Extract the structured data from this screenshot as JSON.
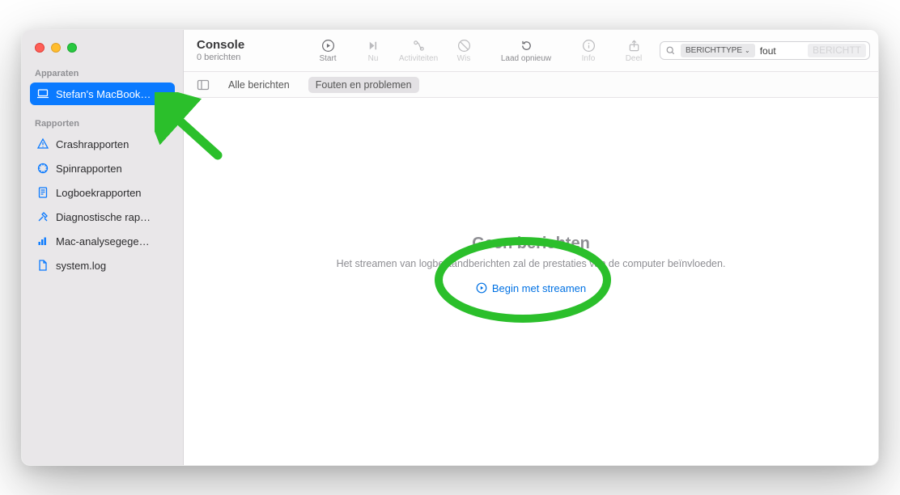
{
  "window": {
    "title": "Console",
    "subtitle": "0 berichten"
  },
  "toolbar": {
    "start": "Start",
    "now": "Nu",
    "activities": "Activiteiten",
    "clear": "Wis",
    "reload": "Laad opnieuw",
    "info": "Info",
    "share": "Deel"
  },
  "search": {
    "token_label": "BERICHTTYPE",
    "token_chevron": "⌄",
    "query": "fout",
    "trailing_token": "BERICHTT"
  },
  "filterbar": {
    "all": "Alle berichten",
    "errors": "Fouten en problemen"
  },
  "sidebar": {
    "devices_header": "Apparaten",
    "reports_header": "Rapporten",
    "device": "Stefan's MacBook…",
    "items": [
      {
        "label": "Crashrapporten"
      },
      {
        "label": "Spinrapporten"
      },
      {
        "label": "Logboekrapporten"
      },
      {
        "label": "Diagnostische rap…"
      },
      {
        "label": "Mac-analysegege…"
      },
      {
        "label": "system.log"
      }
    ]
  },
  "empty_state": {
    "heading": "Geen berichten",
    "body": "Het streamen van logbestandberichten zal de prestaties van de computer beïnvloeden.",
    "action": "Begin met streamen"
  },
  "annotation": {
    "color": "#2bbf2b"
  }
}
